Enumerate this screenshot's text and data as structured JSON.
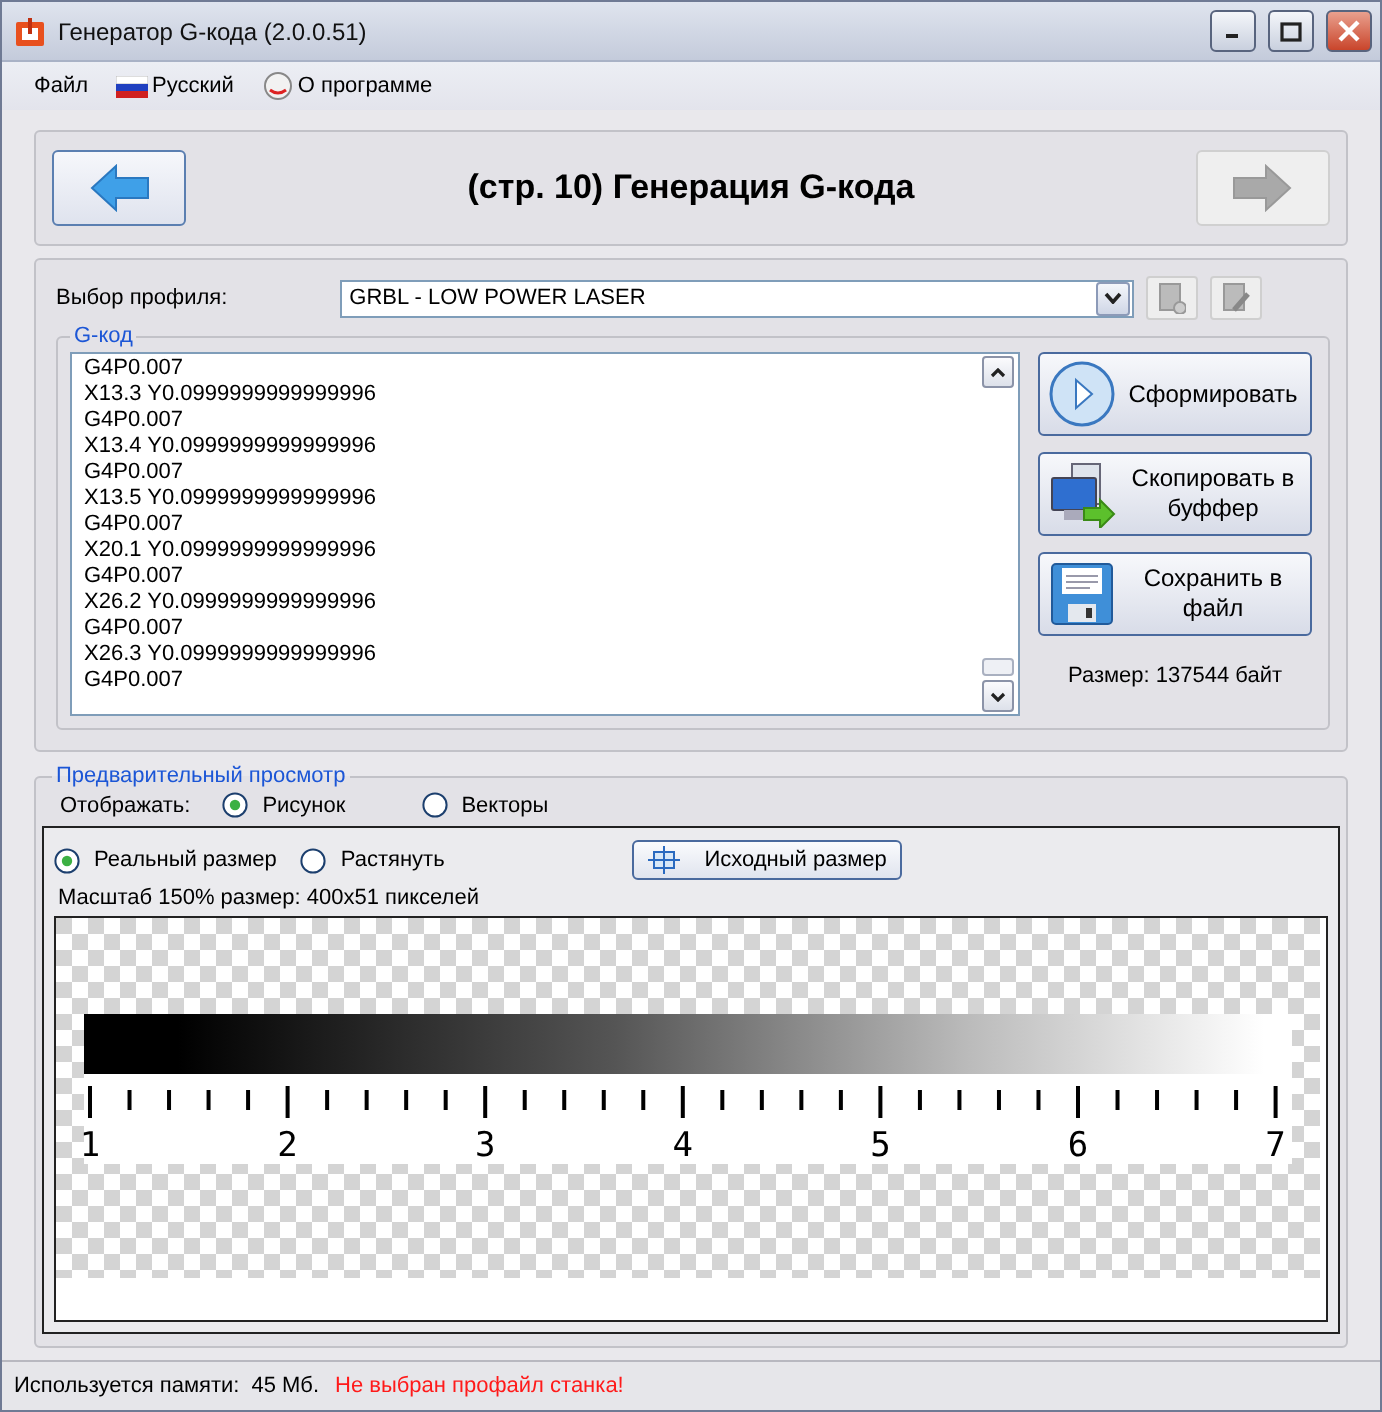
{
  "window": {
    "title": "Генератор G-кода (2.0.0.51)"
  },
  "menu": [
    {
      "kind": "text",
      "label": "Файл"
    },
    {
      "kind": "flag",
      "label": "Русский"
    },
    {
      "kind": "about",
      "label": "О программе"
    }
  ],
  "header": {
    "title": "(стр. 10) Генерация G-кода",
    "back_disabled": false,
    "next_disabled": true
  },
  "profile": {
    "label": "Выбор профиля:",
    "value": "GRBL - LOW POWER LASER"
  },
  "gcode": {
    "legend": "G-код",
    "lines": [
      "G4P0.007",
      "X13.3 Y0.0999999999999996",
      "G4P0.007",
      "X13.4 Y0.0999999999999996",
      "G4P0.007",
      "X13.5 Y0.0999999999999996",
      "G4P0.007",
      "X20.1 Y0.0999999999999996",
      "G4P0.007",
      "X26.2 Y0.0999999999999996",
      "G4P0.007",
      "X26.3 Y0.0999999999999996",
      "G4P0.007"
    ]
  },
  "actions": [
    {
      "kind": "generate",
      "label": [
        "Сформировать"
      ]
    },
    {
      "kind": "copy",
      "label": [
        "Скопировать в",
        "буффер"
      ]
    },
    {
      "kind": "save",
      "label": [
        "Сохранить в",
        "файл"
      ]
    }
  ],
  "size": "Размер: 137544 байт",
  "preview": {
    "legend": "Предварительный просмотр",
    "display_label": "Отображать:",
    "display_options": [
      {
        "label": "Рисунок",
        "selected": true
      },
      {
        "label": "Векторы",
        "selected": false
      }
    ],
    "scale_options": [
      {
        "label": "Реальный размер",
        "selected": true
      },
      {
        "label": "Растянуть",
        "selected": false
      }
    ],
    "reset_button": "Исходный размер",
    "info": "Масштаб 150% размер: 400x51 пикселей",
    "ruler_labels": [
      "1",
      "2",
      "3",
      "4",
      "5",
      "6",
      "7"
    ]
  },
  "status": {
    "memory_label": "Используется памяти:",
    "memory_value": "45 Мб.",
    "warning": "Не выбран профайл станка!"
  }
}
